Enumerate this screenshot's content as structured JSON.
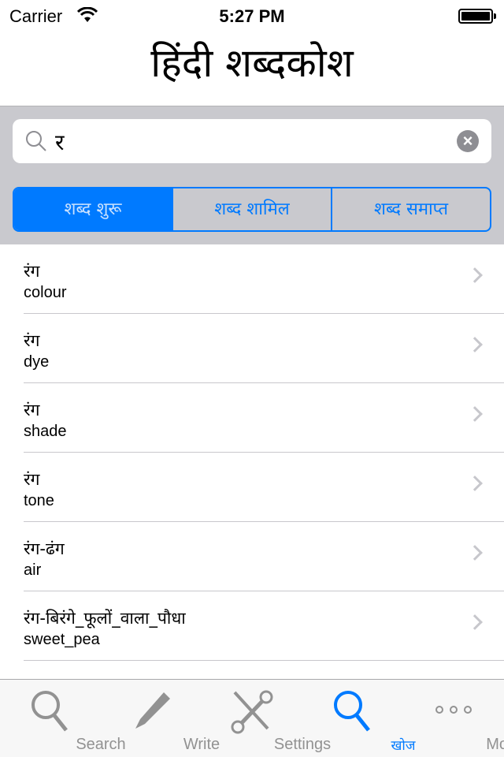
{
  "status": {
    "carrier": "Carrier",
    "time": "5:27 PM"
  },
  "title": "हिंदी शब्दकोश",
  "search": {
    "value": "र"
  },
  "segments": [
    {
      "label": "शब्द शुरू",
      "selected": true
    },
    {
      "label": "शब्द शामिल",
      "selected": false
    },
    {
      "label": "शब्द समाप्त",
      "selected": false
    }
  ],
  "rows": [
    {
      "hindi": "रंग",
      "english": "colour"
    },
    {
      "hindi": "रंग",
      "english": "dye"
    },
    {
      "hindi": "रंग",
      "english": "shade"
    },
    {
      "hindi": "रंग",
      "english": "tone"
    },
    {
      "hindi": "रंग-ढंग",
      "english": "air"
    },
    {
      "hindi": "रंग-बिरंगे_फूलों_वाला_पौधा",
      "english": "sweet_pea"
    }
  ],
  "tabs": [
    {
      "label": "Search",
      "icon": "magnifier-icon"
    },
    {
      "label": "Write",
      "icon": "pencil-icon"
    },
    {
      "label": "Settings",
      "icon": "tools-icon"
    },
    {
      "label": "खोज",
      "icon": "magnifier-icon",
      "selected": true
    },
    {
      "label": "More",
      "icon": "more-icon"
    }
  ],
  "colors": {
    "accent": "#007aff",
    "band": "#c9c9ce"
  }
}
